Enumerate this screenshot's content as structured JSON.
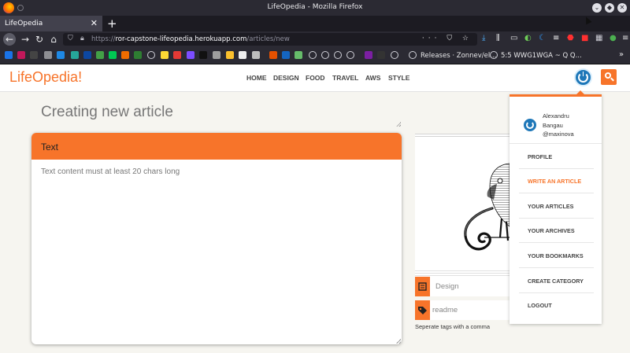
{
  "window": {
    "title": "LifeOpedia - Mozilla Firefox"
  },
  "tab": {
    "label": "LifeOpedia"
  },
  "address": {
    "prefix": "https://",
    "host": "ror-capstone-lifeopedia.herokuapp.com",
    "path": "/articles/new"
  },
  "bookmarks": {
    "releases": "Releases · Zonnev/el...",
    "wwg": "5:5 WWG1WGA ~ Q Q..."
  },
  "site": {
    "logo": "LifeOpedia!",
    "nav": [
      "HOME",
      "DESIGN",
      "FOOD",
      "TRAVEL",
      "AWS",
      "STYLE"
    ]
  },
  "form": {
    "title_placeholder": "Creating new article",
    "text_header": "Text",
    "text_placeholder": "Text content must at least 20 chars long",
    "category_value": "Design",
    "tags_value": "readme",
    "tags_hint": "Seperate tags with a comma"
  },
  "user": {
    "first": "Alexandru",
    "last": "Bangau",
    "handle": "@maxinova"
  },
  "menu": [
    {
      "label": "PROFILE",
      "active": false
    },
    {
      "label": "WRITE AN ARTICLE",
      "active": true
    },
    {
      "label": "YOUR ARTICLES",
      "active": false
    },
    {
      "label": "YOUR ARCHIVES",
      "active": false
    },
    {
      "label": "YOUR BOOKMARKS",
      "active": false
    },
    {
      "label": "CREATE CATEGORY",
      "active": false
    },
    {
      "label": "LOGOUT",
      "active": false
    }
  ],
  "colors": {
    "accent": "#f7742a",
    "avatar": "#1e77b8"
  },
  "icons": {
    "search": "search-icon",
    "avatar": "power-icon",
    "category": "list-icon",
    "tags": "tag-icon"
  }
}
